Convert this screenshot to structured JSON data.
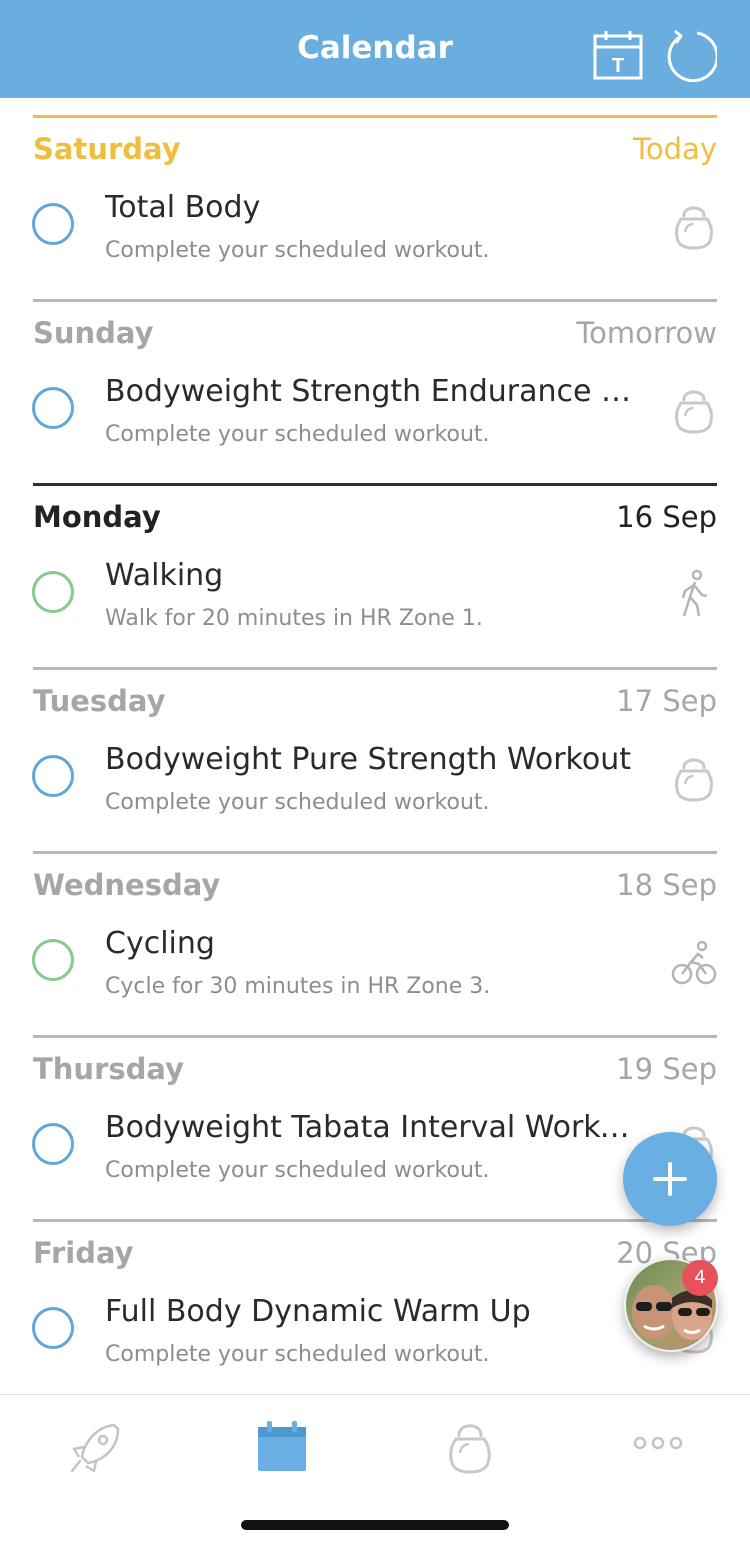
{
  "header": {
    "title": "Calendar",
    "today_button_letter": "T"
  },
  "days": [
    {
      "day": "Saturday",
      "date": "Today",
      "state": "today",
      "title": "Total Body",
      "subtitle": "Complete your scheduled workout.",
      "check_color": "#5ea7dd",
      "icon": "kettlebell-icon"
    },
    {
      "day": "Sunday",
      "date": "Tomorrow",
      "state": "normal",
      "title": "Bodyweight Strength Endurance W...",
      "subtitle": "Complete your scheduled workout.",
      "check_color": "#5ea7dd",
      "icon": "kettlebell-icon"
    },
    {
      "day": "Monday",
      "date": "16 Sep",
      "state": "strong",
      "title": "Walking",
      "subtitle": "Walk for 20 minutes in HR Zone 1.",
      "check_color": "#86c98a",
      "icon": "walking-icon"
    },
    {
      "day": "Tuesday",
      "date": "17 Sep",
      "state": "normal",
      "title": "Bodyweight Pure Strength Workout",
      "subtitle": "Complete your scheduled workout.",
      "check_color": "#5ea7dd",
      "icon": "kettlebell-icon"
    },
    {
      "day": "Wednesday",
      "date": "18 Sep",
      "state": "normal",
      "title": "Cycling",
      "subtitle": "Cycle for 30 minutes in HR Zone 3.",
      "check_color": "#86c98a",
      "icon": "cycling-icon"
    },
    {
      "day": "Thursday",
      "date": "19 Sep",
      "state": "normal",
      "title": "Bodyweight Tabata Interval Workout",
      "subtitle": "Complete your scheduled workout.",
      "check_color": "#5ea7dd",
      "icon": "kettlebell-icon"
    },
    {
      "day": "Friday",
      "date": "20 Sep",
      "state": "normal",
      "title": "Full Body Dynamic Warm Up",
      "subtitle": "Complete your scheduled workout.",
      "check_color": "#5ea7dd",
      "icon": "kettlebell-icon"
    }
  ],
  "fab": {
    "icon": "plus-icon"
  },
  "chat_head": {
    "badge_count": "4"
  },
  "tabbar": {
    "tabs": [
      {
        "icon": "rocket-icon",
        "active": false
      },
      {
        "icon": "calendar-icon",
        "active": true
      },
      {
        "icon": "kettlebell-icon",
        "active": false
      },
      {
        "icon": "more-icon",
        "active": false
      }
    ]
  },
  "colors": {
    "accent": "#6aaee0",
    "today": "#efbe3c",
    "badge": "#e8505b"
  }
}
